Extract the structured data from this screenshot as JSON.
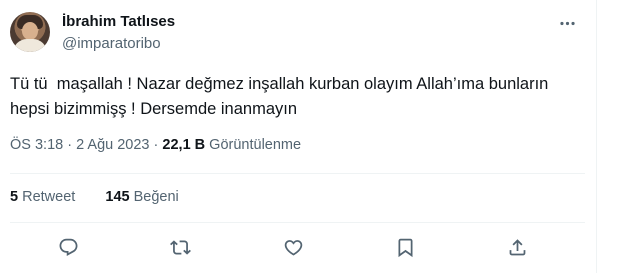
{
  "author": {
    "name": "İbrahim Tatlıses",
    "handle": "@imparatoribo"
  },
  "tweet": {
    "text": "Tü tü  maşallah ! Nazar değmez inşallah kurban olayım Allah’ıma bunların hepsi bizimmişş ! Dersemde inanmayın",
    "time": "ÖS 3:18",
    "separator": "·",
    "date": "2 Ağu 2023",
    "views_count": "22,1 B",
    "views_label": "Görüntülenme"
  },
  "stats": {
    "retweets_count": "5",
    "retweets_label": "Retweet",
    "likes_count": "145",
    "likes_label": "Beğeni"
  },
  "icons": {
    "more": "more-horizontal-icon",
    "reply": "reply-icon",
    "retweet": "retweet-icon",
    "like": "heart-icon",
    "bookmark": "bookmark-icon",
    "share": "share-icon"
  },
  "colors": {
    "text": "#0f1419",
    "secondary": "#536471",
    "divider": "#eff3f4"
  }
}
